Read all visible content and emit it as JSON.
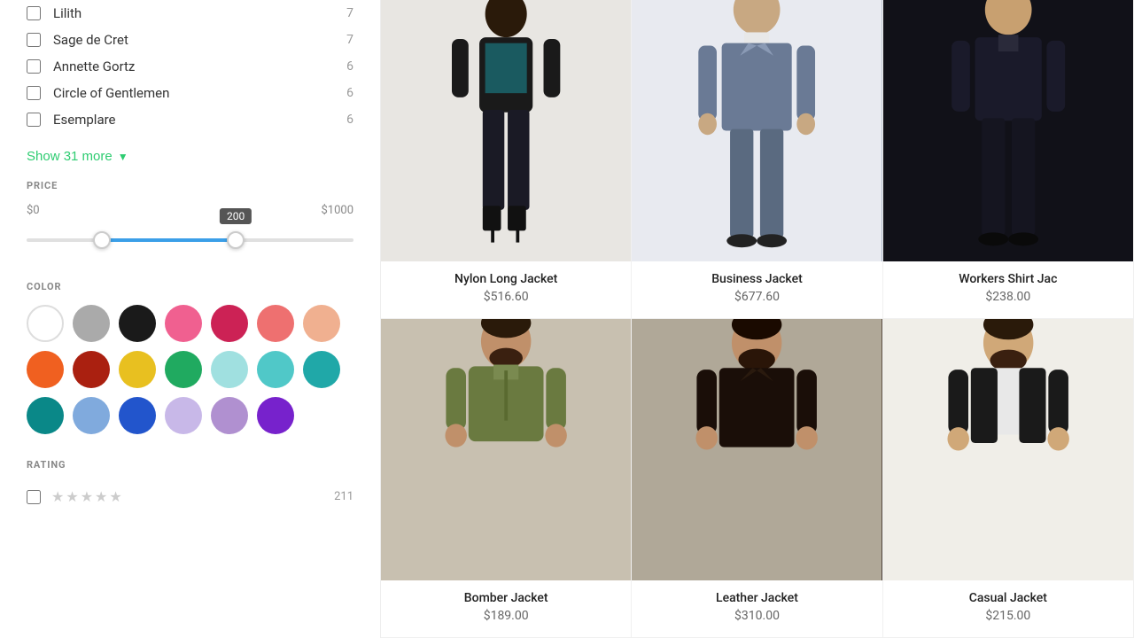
{
  "sidebar": {
    "brands": [
      {
        "name": "Lilith",
        "count": 7,
        "checked": false
      },
      {
        "name": "Sage de Cret",
        "count": 7,
        "checked": false
      },
      {
        "name": "Annette Gortz",
        "count": 6,
        "checked": false
      },
      {
        "name": "Circle of Gentlemen",
        "count": 6,
        "checked": false
      },
      {
        "name": "Esemplare",
        "count": 6,
        "checked": false
      }
    ],
    "show_more_label": "Show 31 more",
    "price": {
      "label": "PRICE",
      "min_label": "$0",
      "max_label": "$1000",
      "current_value": "200",
      "tooltip": "200"
    },
    "color": {
      "label": "COLOR",
      "swatches": [
        {
          "id": "white",
          "hex": "#FFFFFF",
          "border": "#ddd"
        },
        {
          "id": "gray",
          "hex": "#AAAAAA"
        },
        {
          "id": "black",
          "hex": "#1A1A1A"
        },
        {
          "id": "hot-pink",
          "hex": "#F06090"
        },
        {
          "id": "crimson",
          "hex": "#CC2255"
        },
        {
          "id": "salmon",
          "hex": "#EE7070"
        },
        {
          "id": "peach",
          "hex": "#F0B090"
        },
        {
          "id": "orange",
          "hex": "#F06020"
        },
        {
          "id": "dark-red",
          "hex": "#AA2010"
        },
        {
          "id": "yellow",
          "hex": "#E8C020"
        },
        {
          "id": "green",
          "hex": "#20AA60"
        },
        {
          "id": "light-cyan",
          "hex": "#A0E0E0"
        },
        {
          "id": "medium-cyan",
          "hex": "#50C8C8"
        },
        {
          "id": "teal",
          "hex": "#20A8A8"
        },
        {
          "id": "dark-teal",
          "hex": "#0A8888"
        },
        {
          "id": "light-blue",
          "hex": "#80AADD"
        },
        {
          "id": "blue",
          "hex": "#2255CC"
        },
        {
          "id": "lavender",
          "hex": "#C8B8E8"
        },
        {
          "id": "lilac",
          "hex": "#B090D0"
        },
        {
          "id": "purple",
          "hex": "#7722CC"
        }
      ]
    },
    "rating": {
      "label": "RATING",
      "items": [
        {
          "stars": 5,
          "count": 211
        }
      ]
    }
  },
  "products": [
    {
      "name": "Nylon Long Jacket",
      "price": "$516.60",
      "img_class": "img-p1",
      "figure": "standing-woman-heels"
    },
    {
      "name": "Business Jacket",
      "price": "$677.60",
      "img_class": "img-p2",
      "figure": "standing-man-suit"
    },
    {
      "name": "Workers Shirt Jac",
      "price": "$238.00",
      "img_class": "img-p3",
      "figure": "standing-man-dark"
    },
    {
      "name": "Bomber Jacket",
      "price": "$189.00",
      "img_class": "img-p4",
      "figure": "man-olive-jacket"
    },
    {
      "name": "Leather Jacket",
      "price": "$310.00",
      "img_class": "img-p5",
      "figure": "man-leather-jacket"
    },
    {
      "name": "Casual Jacket",
      "price": "$215.00",
      "img_class": "img-p6",
      "figure": "man-light-jacket"
    }
  ]
}
